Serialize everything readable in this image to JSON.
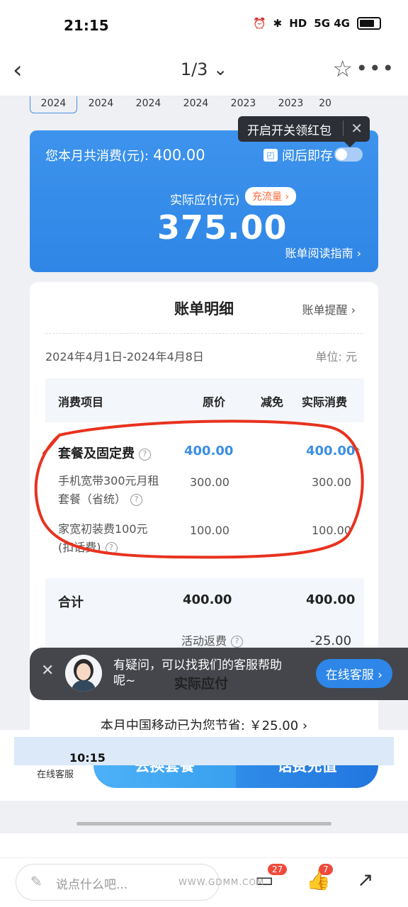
{
  "status_bar": {
    "time": "21:15",
    "network": "5G  4G",
    "hd": "HD"
  },
  "nav": {
    "back": "‹",
    "title": "1/3 ⌄",
    "star": "☆",
    "more": "•••"
  },
  "year_tabs": [
    "2024",
    "2024",
    "2024",
    "2024",
    "2023",
    "2023",
    "20"
  ],
  "tooltip": {
    "text": "开启开关领红包",
    "close": "✕"
  },
  "summary": {
    "total_label": "您本月共消费(元):",
    "total_value": "400.00",
    "save_label": "阅后即存",
    "actual_label": "实际应付(元)",
    "flow_button": "充流量 ›",
    "actual_amount": "375.00",
    "guide_link": "账单阅读指南 ›"
  },
  "detail": {
    "title": "账单明细",
    "remind": "账单提醒 ›",
    "date_range": "2024年4月1日-2024年4月8日",
    "unit": "单位: 元",
    "headers": {
      "item": "消费项目",
      "original": "原价",
      "discount": "减免",
      "actual": "实际消费"
    },
    "group": {
      "name": "套餐及固定费",
      "original": "400.00",
      "actual": "400.00",
      "caret": "^"
    },
    "items": [
      {
        "name_line1": "手机宽带300元月租",
        "name_line2": "套餐（省统）",
        "original": "300.00",
        "actual": "300.00"
      },
      {
        "name_line1": "家宽初装费100元",
        "name_line2": "(扣话费)",
        "original": "100.00",
        "actual": "100.00"
      }
    ],
    "total": {
      "label": "合计",
      "original": "400.00",
      "actual": "400.00"
    },
    "promo": {
      "label": "活动返费",
      "value": "-25.00"
    },
    "actual_pay_label": "实际应付"
  },
  "cs_banner": {
    "text": "有疑问，可以找我们的客服帮助呢~",
    "button": "在线客服 ›",
    "close": "✕"
  },
  "savings": "本月中国移动已为您节省: ￥25.00 ›",
  "actions": {
    "service_label": "在线客服",
    "change_plan": "去换套餐",
    "recharge": "话费充值"
  },
  "next_page": {
    "time": "10:15"
  },
  "bottom": {
    "comment_placeholder": "说点什么吧...",
    "comment_count": "27",
    "like_count": "7",
    "watermark": "WWW.GDMM.COM"
  },
  "colors": {
    "accent_blue": "#3a8ee6",
    "card_blue": "#3d93ec",
    "annotation_red": "#e8321f"
  }
}
